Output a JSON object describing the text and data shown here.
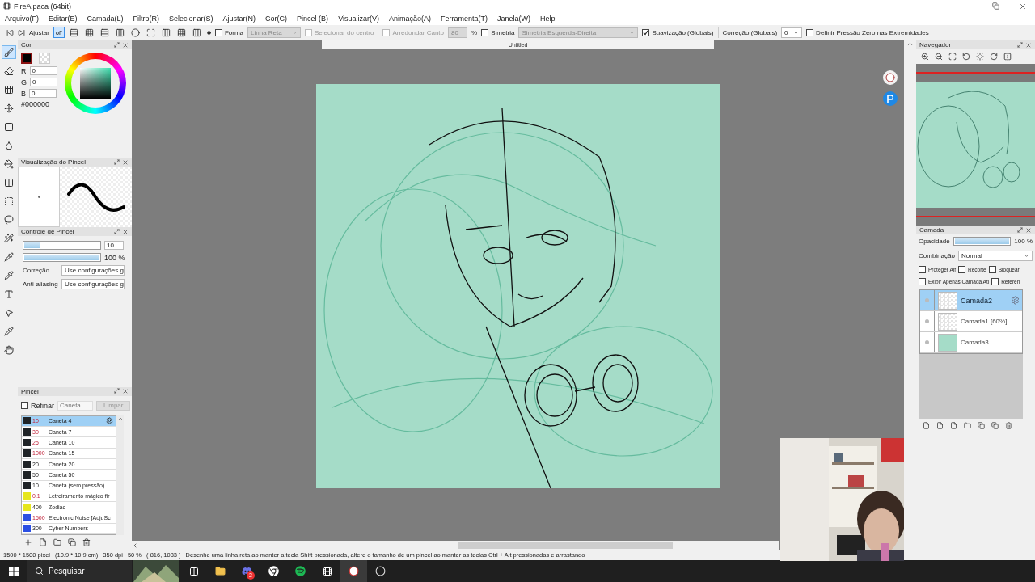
{
  "window": {
    "title": "FireAlpaca (64bit)"
  },
  "menu": [
    "Arquivo(F)",
    "Editar(E)",
    "Camada(L)",
    "Filtro(R)",
    "Selecionar(S)",
    "Ajustar(N)",
    "Cor(C)",
    "Pincel (B)",
    "Visualizar(V)",
    "Animação(A)",
    "Ferramenta(T)",
    "Janela(W)",
    "Help"
  ],
  "toolbar": {
    "adjust_label": "Ajustar",
    "snap_off": {
      "label": "off",
      "selected": true
    },
    "shape": {
      "label": "Forma",
      "checked": false
    },
    "shape_type": {
      "value": "Linha Reta",
      "disabled": true
    },
    "from_center": {
      "label": "Selecionar do centro",
      "checked": false,
      "disabled": true
    },
    "round_corner": {
      "label": "Arredondar Canto",
      "checked": false,
      "disabled": true
    },
    "round_value": "80",
    "round_unit": "%",
    "symmetry": {
      "label": "Simetria",
      "checked": false
    },
    "symmetry_type": {
      "value": "Simetria Esquerda-Direita",
      "disabled": true
    },
    "smoothing": {
      "label": "Suavização (Globais)",
      "checked": true
    },
    "correction_label": "Correção (Globais)",
    "correction_value": "0",
    "zero_pressure": {
      "label": "Definir Pressão Zero nas Extremidades",
      "checked": false
    }
  },
  "color_panel": {
    "title": "Cor",
    "r": "0",
    "g": "0",
    "b": "0",
    "r_label": "R",
    "g_label": "G",
    "b_label": "B",
    "hex": "#000000"
  },
  "brush_preview": {
    "title": "Visualização do Pincel"
  },
  "brush_control": {
    "title": "Controle de Pincel",
    "size": {
      "level": 0.2,
      "value": "10"
    },
    "opacity": {
      "level": 1.0,
      "reading": "100 %"
    },
    "correction": {
      "label": "Correção",
      "value": "Use configurações g"
    },
    "antialias": {
      "label": "Anti-aliasing",
      "value": "Use configurações g"
    }
  },
  "brush_panel": {
    "title": "Pincel",
    "refine": {
      "label": "Refinar",
      "checked": false
    },
    "search": {
      "placeholder": "Caneta"
    },
    "clear": {
      "label": "Limpar",
      "disabled": true
    },
    "brushes": [
      {
        "color": "#1f2326",
        "size": "10",
        "pressure": true,
        "name": "Caneta 4",
        "selected": true
      },
      {
        "color": "#1f2326",
        "size": "30",
        "pressure": true,
        "name": "Caneta 7",
        "selected": false
      },
      {
        "color": "#1f2326",
        "size": "25",
        "pressure": true,
        "name": "Caneta 10",
        "selected": false
      },
      {
        "color": "#1f2326",
        "size": "1000",
        "pressure": true,
        "name": "Caneta 15",
        "selected": false
      },
      {
        "color": "#1f2326",
        "size": "20",
        "pressure": false,
        "name": "Caneta 20",
        "selected": false
      },
      {
        "color": "#1f2326",
        "size": "50",
        "pressure": false,
        "name": "Caneta 50",
        "selected": false
      },
      {
        "color": "#1f2326",
        "size": "10",
        "pressure": false,
        "name": "Caneta (sem pressão)",
        "selected": false
      },
      {
        "color": "#e6e61e",
        "size": "0.1",
        "pressure": true,
        "name": "Letreiramento mágico fir",
        "selected": false
      },
      {
        "color": "#e6e61e",
        "size": "400",
        "pressure": false,
        "name": "Zodiac",
        "selected": false
      },
      {
        "color": "#2b4fe3",
        "size": "1500",
        "pressure": true,
        "name": "Electronic Noise [AdjuSc",
        "selected": false
      },
      {
        "color": "#2b4fe3",
        "size": "300",
        "pressure": false,
        "name": "Cyber Numbers",
        "selected": false
      }
    ]
  },
  "canvas": {
    "tab": "Untitled"
  },
  "navigator": {
    "title": "Navegador"
  },
  "layer_panel": {
    "title": "Camada",
    "opacity": {
      "label": "Opacidade",
      "level": 1.0,
      "reading": "100 %"
    },
    "blend": {
      "label": "Combinação",
      "value": "Normal"
    },
    "options": [
      {
        "label": "Proteger Alf",
        "checked": false
      },
      {
        "label": "Recorte",
        "checked": false
      },
      {
        "label": "Bloquear",
        "checked": false
      },
      {
        "label": "Exibir Apenas Camada Ati",
        "checked": false
      },
      {
        "label": "Referên",
        "checked": false
      }
    ],
    "layers": [
      {
        "name": "Camada2",
        "kind": "transparent",
        "selected": true
      },
      {
        "name": "Camada1 [60%]",
        "kind": "transparent",
        "selected": false
      },
      {
        "name": "Camada3",
        "kind": "fill",
        "selected": false
      }
    ]
  },
  "status_bar": [
    "1500 * 1500 pixel",
    "(10.9 * 10.9 cm)",
    "350 dpi",
    "50 %",
    "( 816, 1033 )",
    "Desenhe uma linha reta ao manter a tecla Shift pressionada, altere o tamanho de um pincel ao manter as teclas Ctrl + Alt pressionadas e arrastando"
  ],
  "taskbar": {
    "search": "Pesquisar",
    "badge": "2"
  }
}
